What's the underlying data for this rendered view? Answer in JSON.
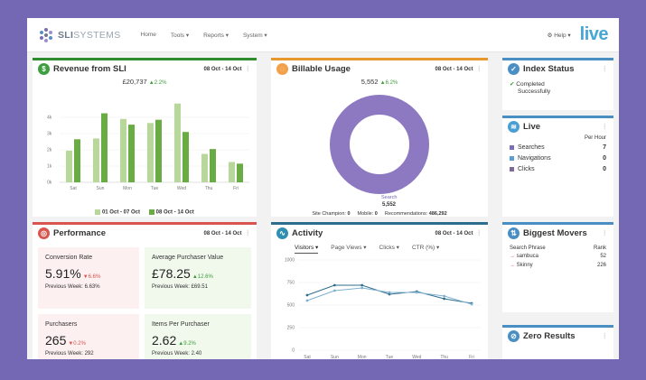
{
  "nav": {
    "logo": "SLI",
    "logo_light": "SYSTEMS",
    "items": [
      "Home",
      "Tools ▾",
      "Reports ▾",
      "System ▾"
    ],
    "help": "Help ▾",
    "brand": "live"
  },
  "revenue": {
    "title": "Revenue from SLI",
    "date": "08 Oct - 14 Oct",
    "total": "£20,737",
    "change": "▲2.2%",
    "legend_prev": "01 Oct - 07 Oct",
    "legend_curr": "08 Oct - 14 Oct"
  },
  "billable": {
    "title": "Billable Usage",
    "date": "08 Oct - 14 Oct",
    "total": "5,552",
    "change": "▲6.2%",
    "slice_label": "Search",
    "slice_value": "5,552",
    "footer_champion_label": "Site Champion:",
    "footer_champion": "0",
    "footer_mobile_label": "Mobile:",
    "footer_mobile": "0",
    "footer_reco_label": "Recommendations:",
    "footer_reco": "486,292"
  },
  "index_status": {
    "title": "Index Status",
    "line1": "Completed",
    "line2": "Successfully"
  },
  "live": {
    "title": "Live",
    "per_hour_1": "Per",
    "per_hour_2": "Hour",
    "rows": [
      {
        "label": "Searches",
        "value": "7"
      },
      {
        "label": "Navigations",
        "value": "0"
      },
      {
        "label": "Clicks",
        "value": "0"
      }
    ]
  },
  "performance": {
    "title": "Performance",
    "date": "08 Oct - 14 Oct",
    "cards": [
      {
        "label": "Conversion Rate",
        "value": "5.91%",
        "change": "▼6.6%",
        "prev": "Previous Week: 6.63%"
      },
      {
        "label": "Average Purchaser Value",
        "value": "£78.25",
        "change": "▲12.6%",
        "prev": "Previous Week: £69.51"
      },
      {
        "label": "Purchasers",
        "value": "265",
        "change": "▼0.2%",
        "prev": "Previous Week: 292"
      },
      {
        "label": "Items Per Purchaser",
        "value": "2.62",
        "change": "▲9.2%",
        "prev": "Previous Week: 2.40"
      }
    ]
  },
  "activity": {
    "title": "Activity",
    "date": "08 Oct - 14 Oct",
    "tabs": [
      "Visitors ▾",
      "Page Views ▾",
      "Clicks ▾",
      "CTR (%) ▾"
    ]
  },
  "biggest_movers": {
    "title": "Biggest Movers",
    "col1": "Search Phrase",
    "col2": "Rank",
    "rows": [
      {
        "phrase": "sambuca",
        "rank": "52"
      },
      {
        "phrase": "Skinny",
        "rank": "226"
      }
    ]
  },
  "zero_results": {
    "title": "Zero Results"
  },
  "colors": {
    "light_green": "#b7d89a",
    "dark_green": "#6aac44",
    "purple": "#8d79c2",
    "blue_line": "#2e6d8e",
    "light_line": "#7fb1cf"
  },
  "chart_data": [
    {
      "type": "bar",
      "categories": [
        "Sat",
        "Sun",
        "Mon",
        "Tue",
        "Wed",
        "Thu",
        "Fri"
      ],
      "series": [
        {
          "name": "01 Oct - 07 Oct",
          "values": [
            1.95,
            2.7,
            3.9,
            3.65,
            4.85,
            1.75,
            1.25
          ]
        },
        {
          "name": "08 Oct - 14 Oct",
          "values": [
            2.65,
            4.25,
            3.55,
            3.85,
            3.1,
            2.05,
            1.15
          ]
        }
      ],
      "yticks": [
        "0k",
        "1k",
        "2k",
        "3k",
        "4k"
      ],
      "ylim": [
        0,
        5
      ]
    },
    {
      "type": "pie",
      "slices": [
        {
          "label": "Search",
          "value": 5552
        }
      ]
    },
    {
      "type": "line",
      "categories": [
        "Sat",
        "Sun",
        "Mon",
        "Tue",
        "Wed",
        "Thu",
        "Fri"
      ],
      "series": [
        {
          "values": [
            610,
            720,
            720,
            620,
            650,
            570,
            520
          ]
        },
        {
          "values": [
            550,
            660,
            690,
            640,
            640,
            600,
            510
          ]
        }
      ],
      "yticks": [
        "1000",
        "750",
        "500",
        "250",
        "0"
      ],
      "ylim": [
        0,
        1000
      ]
    }
  ]
}
